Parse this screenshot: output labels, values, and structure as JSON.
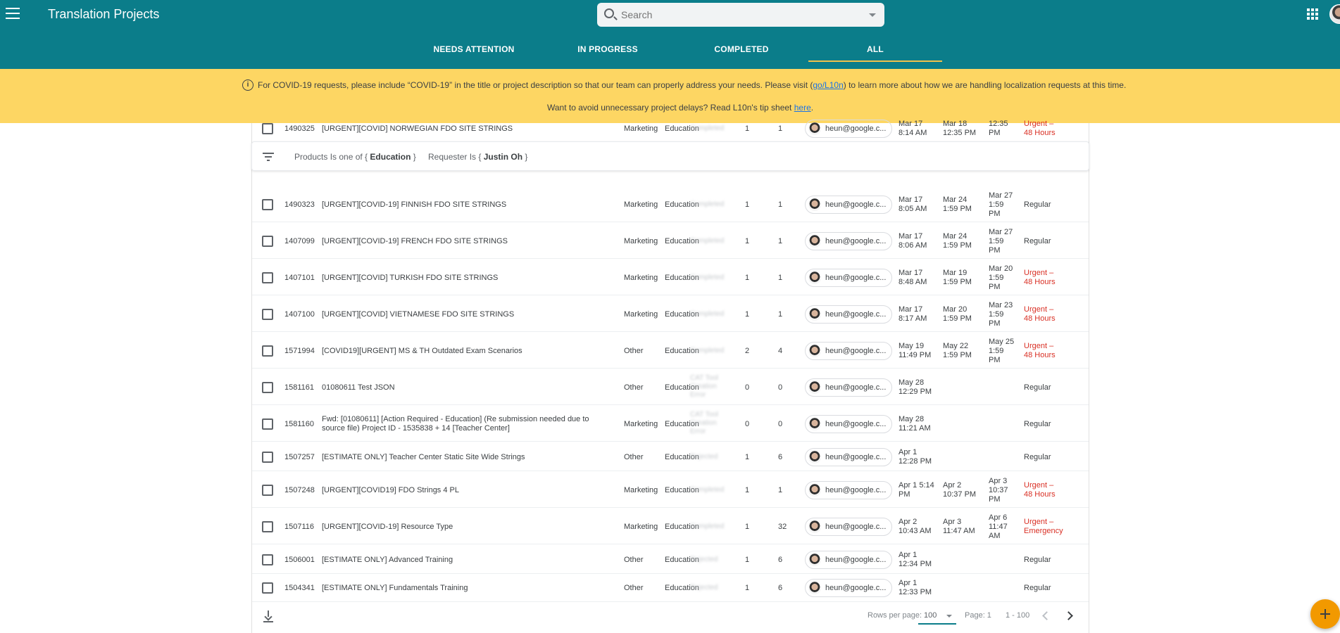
{
  "app": {
    "title": "Translation Projects"
  },
  "search": {
    "placeholder": "Search"
  },
  "tabs": [
    "NEEDS ATTENTION",
    "IN PROGRESS",
    "COMPLETED",
    "ALL"
  ],
  "active_tab": "ALL",
  "banner": {
    "line1_before": "For COVID-19 requests, please include “COVID-19” in the title or project description so that our team can properly address your needs. Please visit (",
    "line1_link": "go/L10n",
    "line1_after": ") to learn more about how we are handling localization requests at this time.",
    "line2_before": "Want to avoid unnecessary project delays? Read L10n's tip sheet ",
    "line2_link": "here",
    "line2_after": "."
  },
  "filters": {
    "products_prefix": "Products Is one of {",
    "products_value": "Education",
    "products_suffix": "}",
    "requester_prefix": "Requester Is {",
    "requester_value": "Justin Oh",
    "requester_suffix": "}"
  },
  "rows": [
    {
      "id": "1490325",
      "title": "[URGENT][COVID] NORWEGIAN FDO SITE STRINGS",
      "type": "Marketing",
      "product": "Education",
      "status": "Completed",
      "n1": "1",
      "n2": "1",
      "owner": "heun@google.c...",
      "d1": "Mar 17\n8:14 AM",
      "d2": "Mar 18\n12:35 PM",
      "d3": "12:35\nPM",
      "priority": "Urgent –\n48 Hours",
      "urgent": true
    },
    {
      "id": "1490323",
      "title": "[URGENT][COVID-19] FINNISH FDO SITE STRINGS",
      "type": "Marketing",
      "product": "Education",
      "status": "Completed",
      "n1": "1",
      "n2": "1",
      "owner": "heun@google.c...",
      "d1": "Mar 17\n8:05 AM",
      "d2": "Mar 24\n1:59 PM",
      "d3": "Mar 27\n1:59\nPM",
      "priority": "Regular",
      "urgent": false
    },
    {
      "id": "1407099",
      "title": "[URGENT][COVID-19] FRENCH FDO SITE STRINGS",
      "type": "Marketing",
      "product": "Education",
      "status": "Completed",
      "n1": "1",
      "n2": "1",
      "owner": "heun@google.c...",
      "d1": "Mar 17\n8:06 AM",
      "d2": "Mar 24\n1:59 PM",
      "d3": "Mar 27\n1:59\nPM",
      "priority": "Regular",
      "urgent": false
    },
    {
      "id": "1407101",
      "title": "[URGENT][COVID] TURKISH FDO SITE STRINGS",
      "type": "Marketing",
      "product": "Education",
      "status": "Completed",
      "n1": "1",
      "n2": "1",
      "owner": "heun@google.c...",
      "d1": "Mar 17\n8:48 AM",
      "d2": "Mar 19\n1:59 PM",
      "d3": "Mar 20\n1:59\nPM",
      "priority": "Urgent –\n48 Hours",
      "urgent": true
    },
    {
      "id": "1407100",
      "title": "[URGENT][COVID] VIETNAMESE FDO SITE STRINGS",
      "type": "Marketing",
      "product": "Education",
      "status": "Completed",
      "n1": "1",
      "n2": "1",
      "owner": "heun@google.c...",
      "d1": "Mar 17\n8:17 AM",
      "d2": "Mar 20\n1:59 PM",
      "d3": "Mar 23\n1:59\nPM",
      "priority": "Urgent –\n48 Hours",
      "urgent": true
    },
    {
      "id": "1571994",
      "title": "[COVID19][URGENT] MS & TH Outdated Exam Scenarios",
      "type": "Other",
      "product": "Education",
      "status": "Completed",
      "n1": "2",
      "n2": "4",
      "owner": "heun@google.c...",
      "d1": "May 19\n11:49 PM",
      "d2": "May 22\n1:59 PM",
      "d3": "May 25\n1:59\nPM",
      "priority": "Urgent –\n48 Hours",
      "urgent": true
    },
    {
      "id": "1581161",
      "title": "01080611 Test JSON",
      "type": "Other",
      "product": "Education",
      "status": "CAT Tool Creation Error",
      "n1": "0",
      "n2": "0",
      "owner": "heun@google.c...",
      "d1": "May 28\n12:29 PM",
      "d2": "",
      "d3": "",
      "priority": "Regular",
      "urgent": false
    },
    {
      "id": "1581160",
      "title": "Fwd: [01080611] [Action Required - Education] (Re submission needed due to source file) Project ID - 1535838 + 14 [Teacher Center]",
      "type": "Marketing",
      "product": "Education",
      "status": "CAT Tool Creation Error",
      "n1": "0",
      "n2": "0",
      "owner": "heun@google.c...",
      "d1": "May 28\n11:21 AM",
      "d2": "",
      "d3": "",
      "priority": "Regular",
      "urgent": false
    },
    {
      "id": "1507257",
      "title": "[ESTIMATE ONLY] Teacher Center Static Site Wide Strings",
      "type": "Other",
      "product": "Education",
      "status": "Rejected",
      "n1": "1",
      "n2": "6",
      "owner": "heun@google.c...",
      "d1": "Apr 1\n12:28 PM",
      "d2": "",
      "d3": "",
      "priority": "Regular",
      "urgent": false
    },
    {
      "id": "1507248",
      "title": "[URGENT][COVID19] FDO Strings 4 PL",
      "type": "Marketing",
      "product": "Education",
      "status": "Completed",
      "n1": "1",
      "n2": "1",
      "owner": "heun@google.c...",
      "d1": "Apr 1 5:14\nPM",
      "d2": "Apr 2\n10:37 PM",
      "d3": "Apr 3\n10:37\nPM",
      "priority": "Urgent –\n48 Hours",
      "urgent": true
    },
    {
      "id": "1507116",
      "title": "[URGENT][COVID-19] Resource Type",
      "type": "Marketing",
      "product": "Education",
      "status": "Completed",
      "n1": "1",
      "n2": "32",
      "owner": "heun@google.c...",
      "d1": "Apr 2\n10:43 AM",
      "d2": "Apr 3\n11:47 AM",
      "d3": "Apr 6\n11:47\nAM",
      "priority": "Urgent –\nEmergency",
      "urgent": true
    },
    {
      "id": "1506001",
      "title": "[ESTIMATE ONLY] Advanced Training",
      "type": "Other",
      "product": "Education",
      "status": "Rejected",
      "n1": "1",
      "n2": "6",
      "owner": "heun@google.c...",
      "d1": "Apr 1\n12:34 PM",
      "d2": "",
      "d3": "",
      "priority": "Regular",
      "urgent": false
    },
    {
      "id": "1504341",
      "title": "[ESTIMATE ONLY] Fundamentals Training",
      "type": "Other",
      "product": "Education",
      "status": "Rejected",
      "n1": "1",
      "n2": "6",
      "owner": "heun@google.c...",
      "d1": "Apr 1\n12:33 PM",
      "d2": "",
      "d3": "",
      "priority": "Regular",
      "urgent": false
    }
  ],
  "footer": {
    "rows_per_page_label": "Rows per page:",
    "rows_per_page_value": "100",
    "page_label": "Page: 1",
    "range_label": "1 - 100"
  },
  "colors": {
    "appbar": "#0b7d8a",
    "banner": "#fdd663",
    "accent": "#f0c14b",
    "urgent": "#d93025",
    "fab": "#f29900"
  }
}
